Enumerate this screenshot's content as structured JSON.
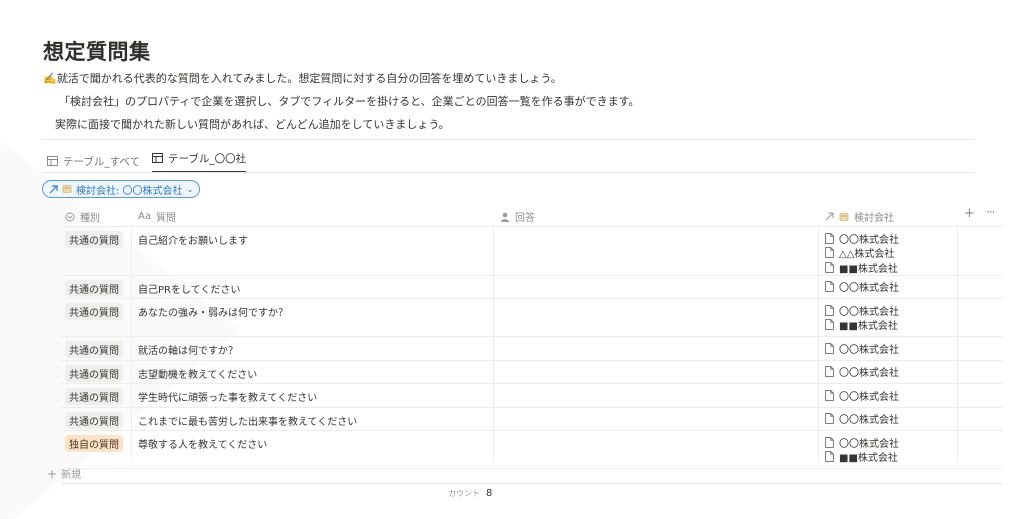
{
  "page": {
    "title": "想定質問集",
    "desc_emoji": "✍️",
    "desc1": "就活で聞かれる代表的な質問を入れてみました。想定質問に対する自分の回答を埋めていきましょう。",
    "desc2": "「検討会社」のプロパティで企業を選択し、タブでフィルターを掛けると、企業ごとの回答一覧を作る事ができます。",
    "desc3": "実際に面接で聞かれた新しい質問があれば、どんどん追加をしていきましょう。"
  },
  "tabs": [
    {
      "label": "テーブル_すべて",
      "icon": "table-icon"
    },
    {
      "label": "テーブル_〇〇社",
      "icon": "table-icon"
    }
  ],
  "filter": {
    "label": "検討会社: 〇〇株式会社",
    "icon": "relation-arrow-icon"
  },
  "columns": {
    "type": "種別",
    "question_prefix": "Aa",
    "question": "質問",
    "answer": "回答",
    "company": "検討会社"
  },
  "rows": [
    {
      "type": "共通の質問",
      "question": "自己紹介をお願いします",
      "companies": [
        "〇〇株式会社",
        "△△株式会社",
        "■■株式会社"
      ]
    },
    {
      "type": "共通の質問",
      "question": "自己PRをしてください",
      "companies": [
        "〇〇株式会社"
      ]
    },
    {
      "type": "共通の質問",
      "question": "あなたの強み・弱みは何ですか？",
      "companies": [
        "〇〇株式会社",
        "■■株式会社"
      ]
    },
    {
      "type": "共通の質問",
      "question": "就活の軸は何ですか？",
      "companies": [
        "〇〇株式会社"
      ]
    },
    {
      "type": "共通の質問",
      "question": "志望動機を教えてください",
      "companies": [
        "〇〇株式会社"
      ]
    },
    {
      "type": "共通の質問",
      "question": "学生時代に頑張った事を教えてください",
      "companies": [
        "〇〇株式会社"
      ]
    },
    {
      "type": "共通の質問",
      "question": "これまでに最も苦労した出来事を教えてください",
      "companies": [
        "〇〇株式会社"
      ]
    },
    {
      "type": "独自の質問",
      "question": "尊敬する人を教えてください",
      "companies": [
        "〇〇株式会社",
        "■■株式会社"
      ]
    }
  ],
  "new_label": "新規",
  "count": {
    "label": "カウント",
    "value": "8"
  },
  "colors": {
    "accent": "#2f7bc6",
    "tag_gray": "#eeeeec",
    "tag_orange": "#fbe3c6"
  }
}
